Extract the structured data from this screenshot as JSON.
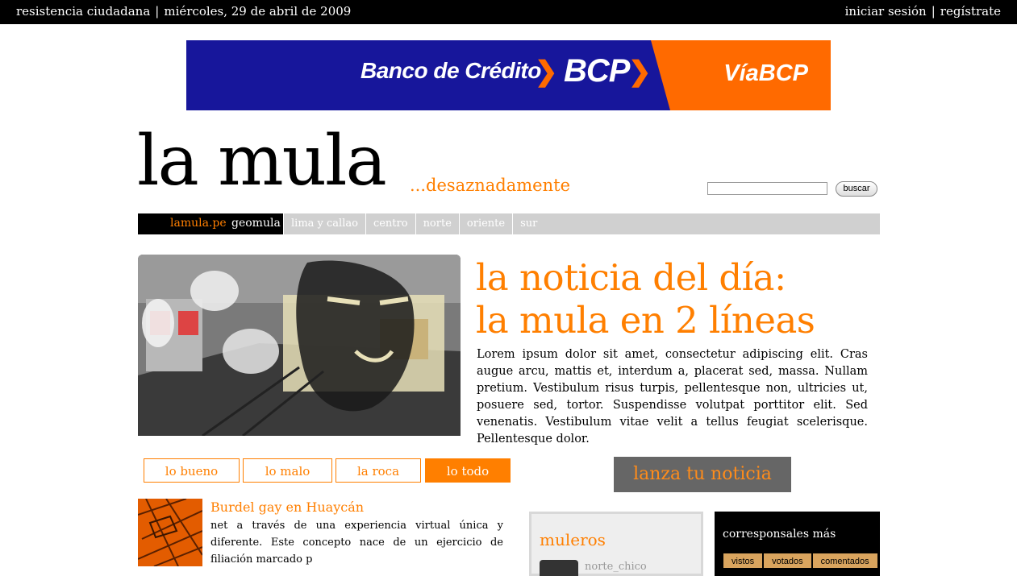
{
  "topbar": {
    "site": "resistencia ciudadana",
    "date": "miércoles, 29 de abril de 2009",
    "login": "iniciar sesión",
    "register": "regístrate"
  },
  "banner": {
    "bank_name": "Banco de Crédito",
    "brand": "BCP",
    "via": "VíaBCP",
    "colors": {
      "blue": "#17169b",
      "orange": "#ff6a00"
    }
  },
  "header": {
    "logo": "la mula",
    "tagline": "...desaznadamente",
    "search_placeholder": "",
    "search_button": "buscar"
  },
  "nav": {
    "home": "lamula.pe",
    "geo": "geomula",
    "items": [
      "lima y callao",
      "centro",
      "norte",
      "oriente",
      "sur"
    ]
  },
  "hero": {
    "title_line1": "la noticia del día:",
    "title_line2": "la mula en 2 líneas",
    "text": "Lorem ipsum dolor sit amet, consectetur adipiscing elit. Cras augue arcu, mattis et, interdum a, placerat sed, massa. Nullam pretium. Vestibulum risus turpis, pellentesque non, ultricies ut, posuere sed, tortor. Suspendisse volutpat porttitor elit. Sed venenatis. Vestibulum vitae velit a tellus feugiat scelerisque. Pellentesque dolor."
  },
  "tabs": [
    "lo bueno",
    "lo malo",
    "la roca",
    "lo todo"
  ],
  "active_tab": "lo todo",
  "lanza": "lanza tu noticia",
  "article": {
    "title": "Burdel gay en Huaycán",
    "snippet": "net a través de una experiencia virtual única y diferente. Este concepto nace de un ejercicio de filiación marcado p"
  },
  "muleros": {
    "title": "muleros",
    "first_name": "norte_chico"
  },
  "corresponsales": {
    "title": "corresponsales más",
    "tabs": [
      "vistos",
      "votados",
      "comentados"
    ]
  },
  "accent_color": "#ff7f00"
}
